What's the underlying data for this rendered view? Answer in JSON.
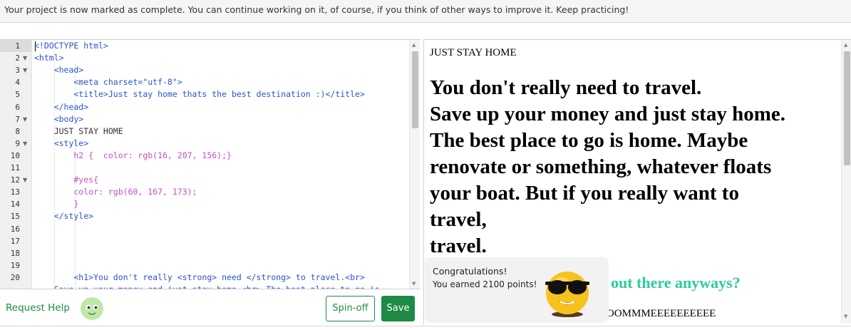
{
  "banner": {
    "message": "Your project is now marked as complete. You can continue working on it, of course, if you think of other ways to improve it. Keep practicing!"
  },
  "editor": {
    "line_numbers": [
      "1",
      "2",
      "3",
      "4",
      "5",
      "6",
      "7",
      "8",
      "9",
      "10",
      "11",
      "12",
      "13",
      "14",
      "15",
      "16",
      "17",
      "18",
      "19",
      "20"
    ],
    "code_lines": [
      "<!DOCTYPE html>",
      "<html>",
      "    <head>",
      "        <meta charset=\"utf-8\">",
      "        <title>Just stay home thats the best destination :)</title>",
      "    </head>",
      "    <body>",
      "    JUST STAY HOME",
      "    <style>",
      "        h2 {  color: rgb(16, 207, 156);}",
      "",
      "        #yes{",
      "        color: rgb(60, 167, 173);",
      "        }",
      "    </style>",
      "",
      "",
      "",
      "",
      "        <h1>You don't really <strong> need </strong> to travel.<br>",
      "    Save up your money and just stay home <br> The best place to go is"
    ]
  },
  "preview": {
    "plain_text": "JUST STAY HOME",
    "h1_lines": [
      "You don't really need to travel.",
      "Save up your money and just stay home.",
      "The best place to go is home. Maybe",
      "renovate or something, whatever floats",
      "your boat. But if you really want to",
      "travel,",
      "travel."
    ],
    "h2_visible": "out there anyways?",
    "small_visible": "OOMMMEEEEEEEEEE"
  },
  "toast": {
    "title": "Congratulations!",
    "body": "You earned 2100 points!"
  },
  "bottom": {
    "help_label": "Request Help",
    "spinoff_label": "Spin-off",
    "save_label": "Save"
  },
  "colors": {
    "accent_green": "#1d8a46",
    "h2_color": "#2ccc9c",
    "tag_blue": "#2a55c8",
    "selector_purple": "#c44ec4"
  }
}
